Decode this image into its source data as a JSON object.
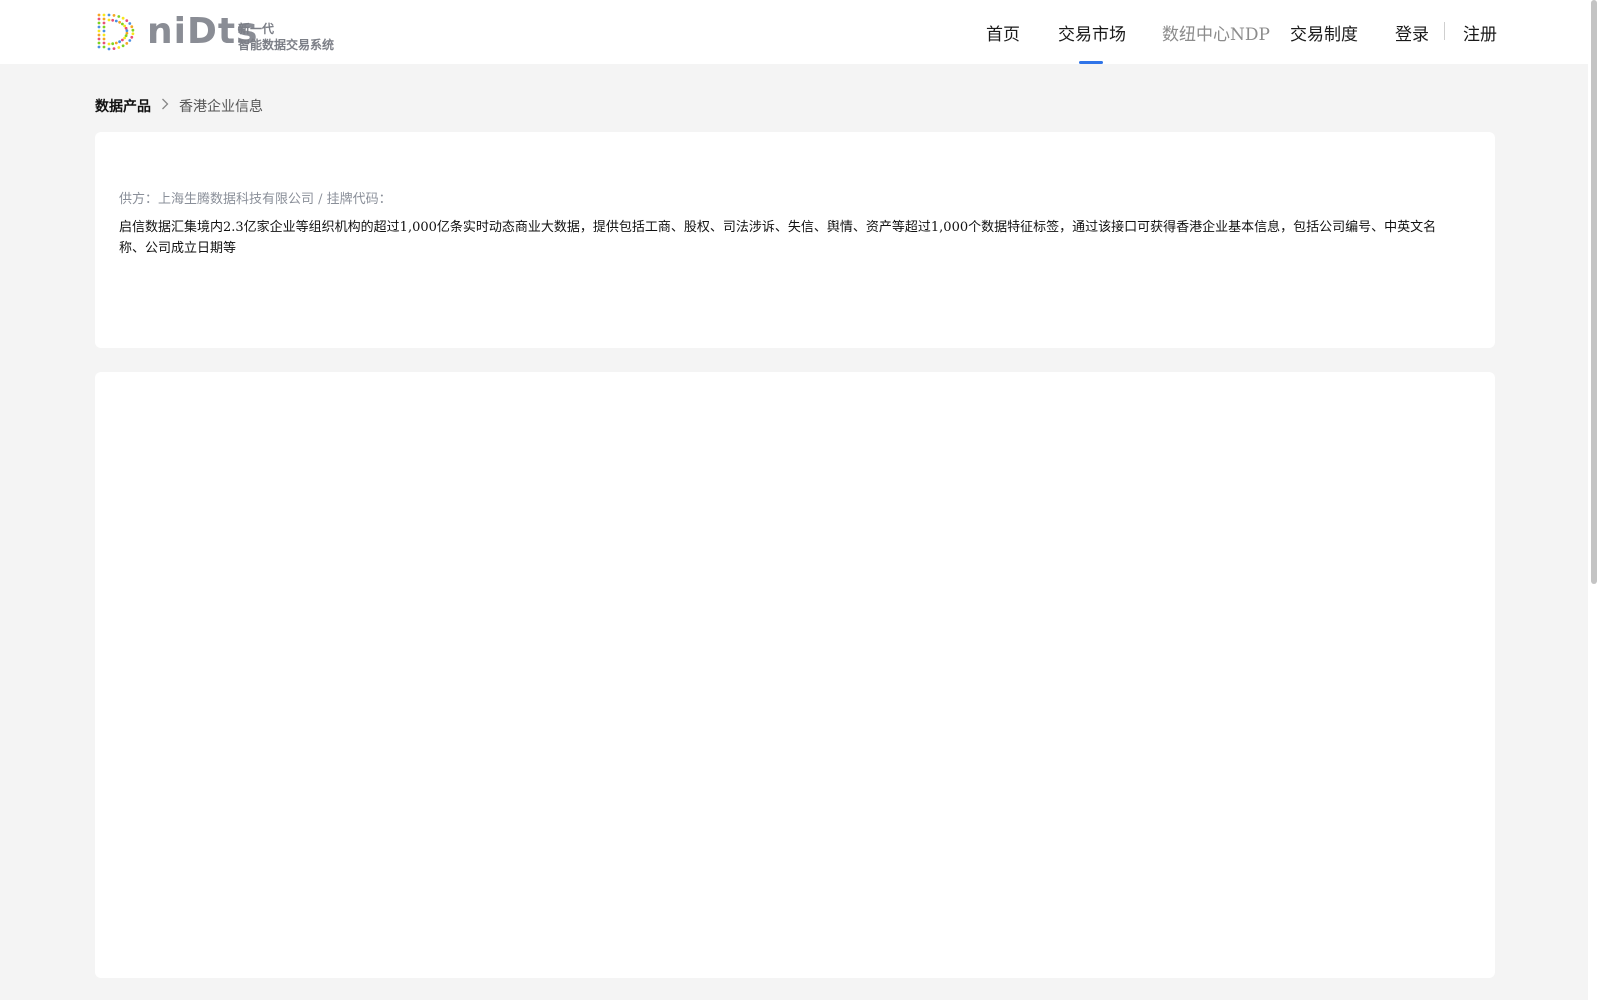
{
  "brand": {
    "wordmark": "niDts",
    "tagline_line1": "新一代",
    "tagline_line2": "智能数据交易系统",
    "logo_colors": [
      "#f5a623",
      "#e94e77",
      "#7ed321",
      "#4a90e2",
      "#f8e71c"
    ]
  },
  "nav": {
    "items": [
      {
        "label": "首页"
      },
      {
        "label": "交易市场"
      },
      {
        "label": "数纽中心NDP"
      },
      {
        "label": "交易制度"
      }
    ],
    "active_index": 1,
    "login": "登录",
    "register": "注册",
    "accent_color": "#2f74e8"
  },
  "breadcrumb": {
    "root": "数据产品",
    "current": "香港企业信息"
  },
  "product": {
    "supplier_line": "供方：上海生腾数据科技有限公司 / 挂牌代码：",
    "description": "启信数据汇集境内2.3亿家企业等组织机构的超过1,000亿条实时动态商业大数据，提供包括工商、股权、司法涉诉、失信、舆情、资产等超过1,000个数据特征标签，通过该接口可获得香港企业基本信息，包括公司编号、中英文名称、公司成立日期等"
  }
}
